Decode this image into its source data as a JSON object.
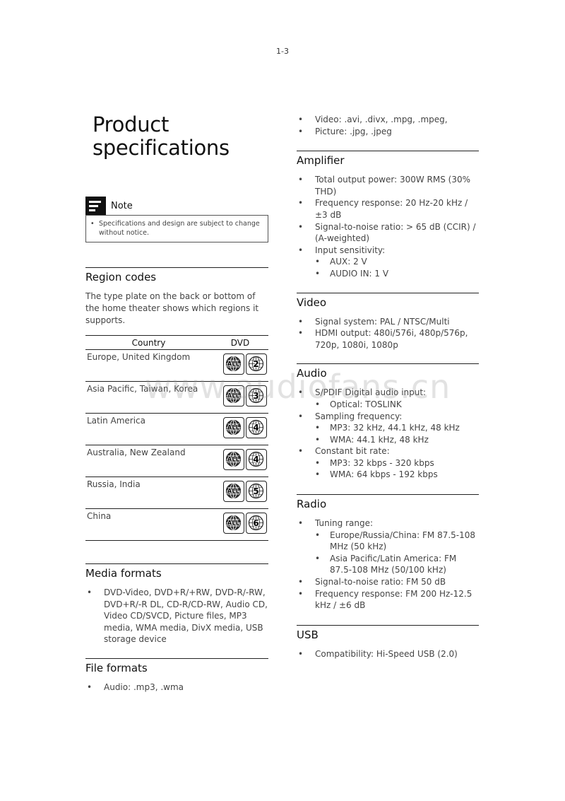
{
  "page_number": "1-3",
  "watermark": "www.audiofans.cn",
  "title_line1": "Product",
  "title_line2": "specifications",
  "note": {
    "label": "Note",
    "icon": "note-icon",
    "text": "Specifications and design are subject to change without notice."
  },
  "region_codes": {
    "heading": "Region codes",
    "description": "The type plate on the back or bottom of the home theater shows which regions it supports.",
    "columns": [
      "Country",
      "DVD"
    ],
    "rows": [
      {
        "country": "Europe, United Kingdom",
        "icons": [
          "ALL",
          "2"
        ]
      },
      {
        "country": "Asia Pacific, Taiwan, Korea",
        "icons": [
          "ALL",
          "3"
        ]
      },
      {
        "country": "Latin America",
        "icons": [
          "ALL",
          "4"
        ]
      },
      {
        "country": "Australia, New Zealand",
        "icons": [
          "ALL",
          "4"
        ]
      },
      {
        "country": "Russia, India",
        "icons": [
          "ALL",
          "5"
        ]
      },
      {
        "country": "China",
        "icons": [
          "ALL",
          "6"
        ]
      }
    ]
  },
  "media_formats": {
    "heading": "Media formats",
    "items": [
      "DVD-Video, DVD+R/+RW, DVD-R/-RW, DVD+R/-R DL, CD-R/CD-RW, Audio CD, Video CD/SVCD, Picture files, MP3 media, WMA media, DivX media, USB storage device"
    ]
  },
  "file_formats": {
    "heading": "File formats",
    "items": [
      "Audio: .mp3, .wma",
      "Video: .avi, .divx, .mpg, .mpeg,",
      "Picture: .jpg, .jpeg"
    ]
  },
  "amplifier": {
    "heading": "Amplifier",
    "items": [
      {
        "text": "Total output power: 300W RMS (30% THD)"
      },
      {
        "text": "Frequency response: 20 Hz-20 kHz / ±3 dB"
      },
      {
        "text": "Signal-to-noise ratio: > 65 dB (CCIR) / (A-weighted)"
      },
      {
        "text": "Input sensitivity:",
        "sub": [
          "AUX: 2 V",
          "AUDIO IN: 1 V"
        ]
      }
    ]
  },
  "video": {
    "heading": "Video",
    "items": [
      {
        "text": "Signal system: PAL / NTSC/Multi"
      },
      {
        "text": "HDMI output: 480i/576i, 480p/576p, 720p, 1080i, 1080p"
      }
    ]
  },
  "audio": {
    "heading": "Audio",
    "items": [
      {
        "text": "S/PDIF Digital audio input:",
        "sub": [
          "Optical: TOSLINK"
        ]
      },
      {
        "text": "Sampling frequency:",
        "sub": [
          "MP3: 32 kHz, 44.1 kHz, 48 kHz",
          "WMA: 44.1 kHz, 48 kHz"
        ]
      },
      {
        "text": "Constant bit rate:",
        "sub": [
          "MP3: 32 kbps - 320 kbps",
          "WMA: 64 kbps - 192 kbps"
        ]
      }
    ]
  },
  "radio": {
    "heading": "Radio",
    "items": [
      {
        "text": "Tuning range:",
        "sub": [
          "Europe/Russia/China: FM 87.5-108 MHz (50 kHz)",
          "Asia Pacific/Latin America: FM 87.5-108 MHz (50/100 kHz)"
        ]
      },
      {
        "text": "Signal-to-noise ratio: FM 50 dB"
      },
      {
        "text": "Frequency response: FM 200 Hz-12.5 kHz / ±6 dB"
      }
    ]
  },
  "usb": {
    "heading": "USB",
    "items": [
      {
        "text": "Compatibility: Hi-Speed USB (2.0)"
      }
    ]
  }
}
